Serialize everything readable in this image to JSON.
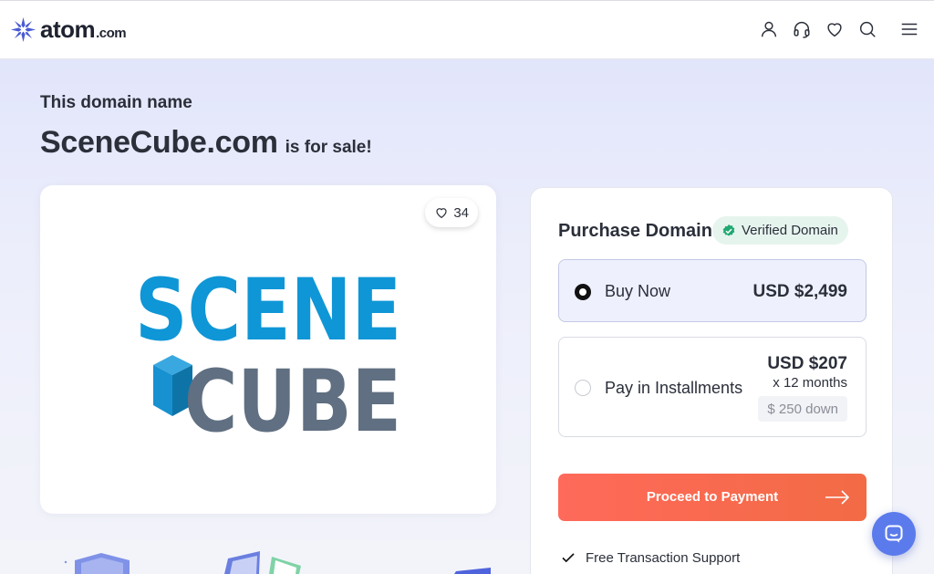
{
  "header": {
    "logo": {
      "text": "atom",
      "suffix": ".com",
      "icon": "atom-star-logo-icon"
    },
    "nav_icons": [
      "user-icon",
      "headset-icon",
      "heart-icon",
      "search-icon",
      "menu-icon"
    ]
  },
  "hero": {
    "eyebrow": "This domain name",
    "domain": "SceneCube.com",
    "for_sale": "is for sale!"
  },
  "logo_card": {
    "likes": "34",
    "brand_logo_text": [
      "SCENE",
      "CUBE"
    ],
    "colors": {
      "scene": "#0f96d6",
      "cube": "#606f81",
      "cube_icon": "#1791d0"
    }
  },
  "purchase": {
    "title": "Purchase Domain",
    "verified_label": "Verified Domain",
    "options": [
      {
        "label": "Buy Now",
        "price": "USD $2,499",
        "selected": true
      },
      {
        "label": "Pay in Installments",
        "price": "USD $207",
        "months": "x 12 months",
        "down": "$ 250 down",
        "selected": false
      }
    ],
    "proceed_label": "Proceed to Payment",
    "features": [
      "Free Transaction Support"
    ]
  },
  "colors": {
    "accent_button": "#f26b45",
    "verified_bg": "#e6f4ee",
    "verified_check": "#1fa971",
    "chat_bubble": "#5b7bec",
    "brand_logo": "#4a5bd4"
  }
}
